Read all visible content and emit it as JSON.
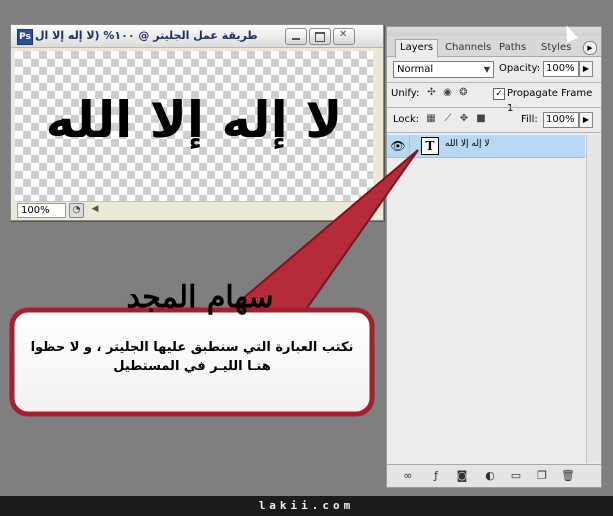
{
  "document": {
    "title": "طريقة عمل الجليتر @ ١٠٠% (لا إله إلا ال",
    "app_icon": "photoshop-icon",
    "canvas_text": "لا إله إلا الله",
    "zoom": "100%"
  },
  "layers_panel": {
    "tabs": [
      "Layers",
      "Channels",
      "Paths",
      "Styles"
    ],
    "blend_mode": "Normal",
    "opacity_label": "Opacity:",
    "opacity_value": "100%",
    "unify_label": "Unify:",
    "propagate_label": "Propagate Frame 1",
    "lock_label": "Lock:",
    "fill_label": "Fill:",
    "fill_value": "100%",
    "layer": {
      "thumb": "T",
      "name": "لا إله إلا الله"
    }
  },
  "callout": {
    "heading": "سهام المجد",
    "text_line1": "نكتب العبارة التي سنطبق عليها الجليتر ، و لا حظوا",
    "text_line2": "هنـا الليـر في المستطيل"
  },
  "footer": {
    "site": "lakii.com"
  }
}
